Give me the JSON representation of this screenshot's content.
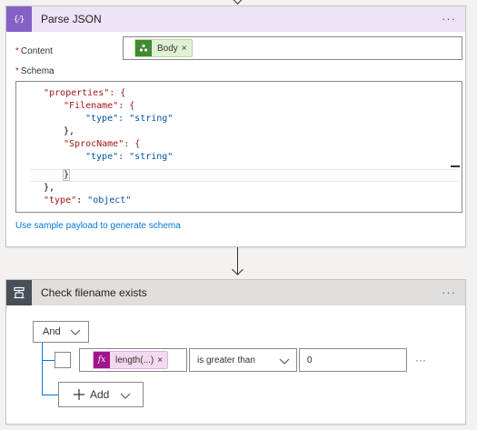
{
  "parse_json": {
    "title": "Parse JSON",
    "icon_glyph": "{⁄}",
    "more": "···",
    "content_label": "Content",
    "content_token": "Body",
    "schema_label": "Schema",
    "required_mark": "*",
    "schema_lines": [
      "\"properties\": {",
      "\"Filename\": {",
      "\"type\": \"string\"",
      "},",
      "\"SprocName\": {",
      "\"type\": \"string\"",
      "}",
      "},",
      "\"type\": \"object\""
    ],
    "sample_link": "Use sample payload to generate schema"
  },
  "condition": {
    "title": "Check filename exists",
    "more": "···",
    "group_operator": "And",
    "left_token": "length(...)",
    "fx_label": "fx",
    "operator": "is greater than",
    "right_value": "0",
    "row_more": "···",
    "add_label": "Add"
  },
  "colors": {
    "parse_json_header": "#ece3f7",
    "parse_json_icon": "#8661c5",
    "condition_header": "#e1dfdd",
    "condition_icon": "#484f58",
    "token_green": "#3f8b2f",
    "fx_purple": "#a0148c",
    "link": "#0078d4"
  },
  "icons": {
    "parse_json": "curly-braces-icon",
    "body_token": "trigger-icon",
    "condition": "condition-icon",
    "add": "plus-icon",
    "chevron": "chevron-down-icon"
  }
}
